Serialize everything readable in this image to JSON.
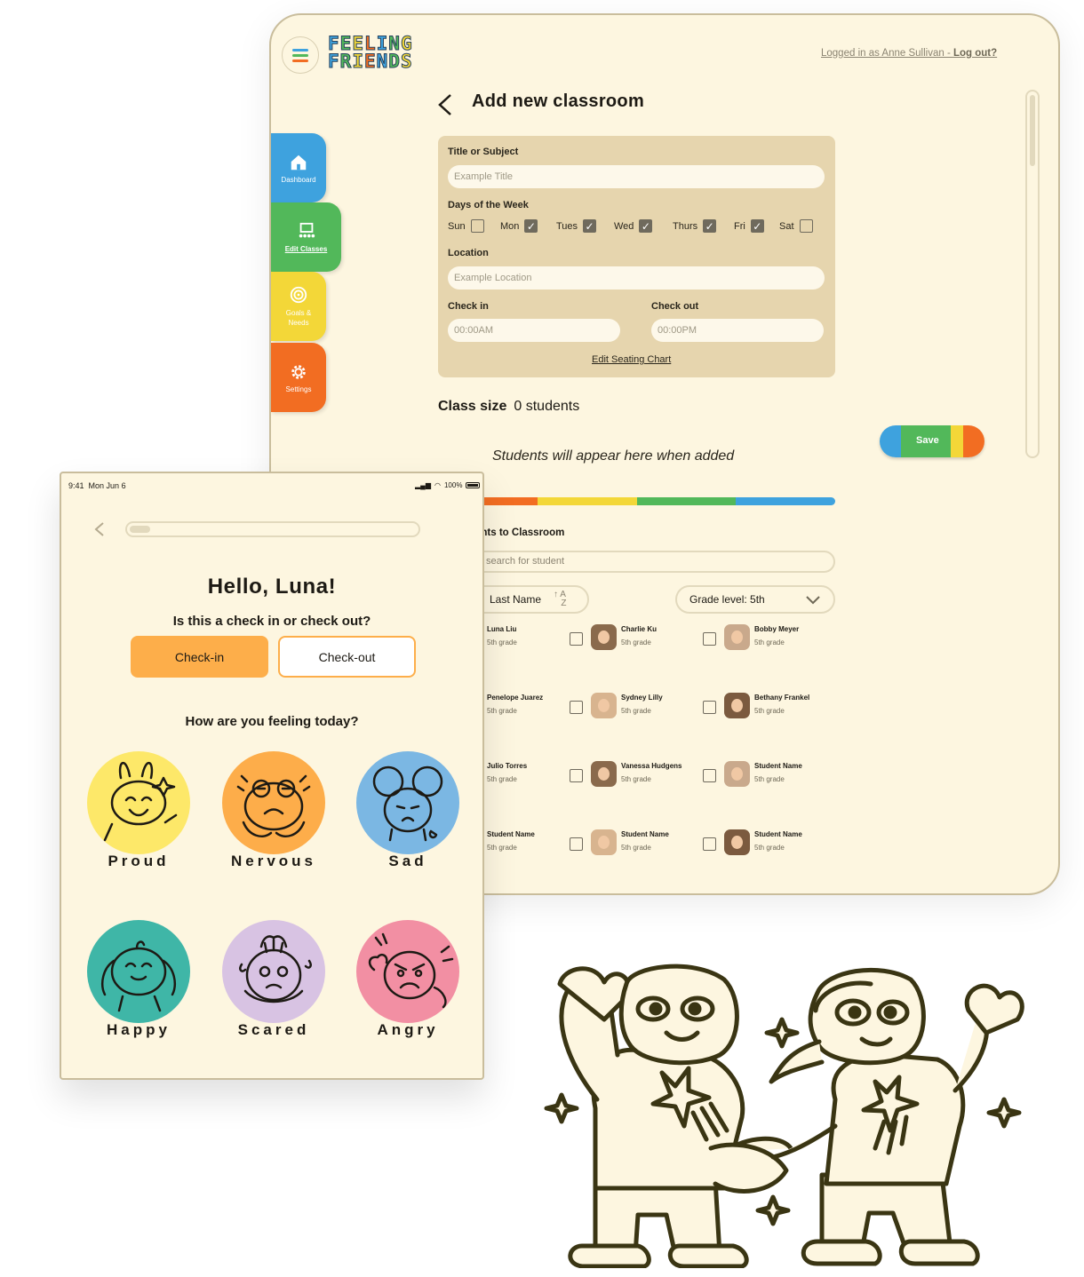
{
  "colors": {
    "cream": "#fdf6e0",
    "tan": "#e6d5ae",
    "blue": "#3ea2de",
    "green": "#52b85a",
    "yellow": "#f3d738",
    "orange": "#f26d22",
    "outline": "#3a3513"
  },
  "desktop": {
    "logo_line1": "FEELING",
    "logo_line2": "FRIENDS",
    "login_prefix": "Logged in as Anne Sullivan - ",
    "logout": "Log out?",
    "sidebar": [
      {
        "label": "Dashboard",
        "icon": "home-icon"
      },
      {
        "label": "Edit Classes",
        "icon": "classroom-icon",
        "active": true
      },
      {
        "label": "Goals & Needs",
        "icon": "target-icon"
      },
      {
        "label": "Settings",
        "icon": "gear-icon"
      }
    ],
    "page_title": "Add new classroom",
    "form": {
      "title_label": "Title or Subject",
      "title_placeholder": "Example Title",
      "days_label": "Days of the Week",
      "days": [
        {
          "label": "Sun",
          "checked": false
        },
        {
          "label": "Mon",
          "checked": true
        },
        {
          "label": "Tues",
          "checked": true
        },
        {
          "label": "Wed",
          "checked": true
        },
        {
          "label": "Thurs",
          "checked": true
        },
        {
          "label": "Fri",
          "checked": true
        },
        {
          "label": "Sat",
          "checked": false
        }
      ],
      "location_label": "Location",
      "location_placeholder": "Example Location",
      "checkin_label": "Check in",
      "checkin_placeholder": "00:00AM",
      "checkout_label": "Check out",
      "checkout_placeholder": "00:00PM",
      "seating_link": "Edit Seating Chart"
    },
    "class_size_label": "Class size",
    "class_size_value": "0 students",
    "save_label": "Save",
    "empty_message": "Students will appear here when added",
    "add_title": "ents to Classroom",
    "search_placeholder": "search for student",
    "sort_label": "Last Name",
    "grade_filter": "Grade level: 5th",
    "students": [
      {
        "name": "Luna Liu",
        "grade": "5th grade"
      },
      {
        "name": "Charlie Ku",
        "grade": "5th grade"
      },
      {
        "name": "Bobby Meyer",
        "grade": "5th grade"
      },
      {
        "name": "Penelope Juarez",
        "grade": "5th grade"
      },
      {
        "name": "Sydney Lilly",
        "grade": "5th grade"
      },
      {
        "name": "Bethany Frankel",
        "grade": "5th grade"
      },
      {
        "name": "Julio Torres",
        "grade": "5th grade"
      },
      {
        "name": "Vanessa Hudgens",
        "grade": "5th grade"
      },
      {
        "name": "Student Name",
        "grade": "5th grade"
      },
      {
        "name": "Student Name",
        "grade": "5th grade"
      },
      {
        "name": "Student Name",
        "grade": "5th grade"
      },
      {
        "name": "Student Name",
        "grade": "5th grade"
      }
    ]
  },
  "tablet": {
    "time": "9:41",
    "date": "Mon Jun 6",
    "battery": "100%",
    "progress": 0.07,
    "greeting": "Hello, Luna!",
    "question": "Is this a check in or check out?",
    "checkin_label": "Check-in",
    "checkout_label": "Check-out",
    "feeling_question": "How are you feeling today?",
    "emotions": [
      {
        "label": "Proud",
        "color": "#fde869"
      },
      {
        "label": "Nervous",
        "color": "#fdad4a"
      },
      {
        "label": "Sad",
        "color": "#7bb7e3"
      },
      {
        "label": "Happy",
        "color": "#3fb6a7"
      },
      {
        "label": "Scared",
        "color": "#d8c3e3"
      },
      {
        "label": "Angry",
        "color": "#f28fa3"
      }
    ]
  }
}
